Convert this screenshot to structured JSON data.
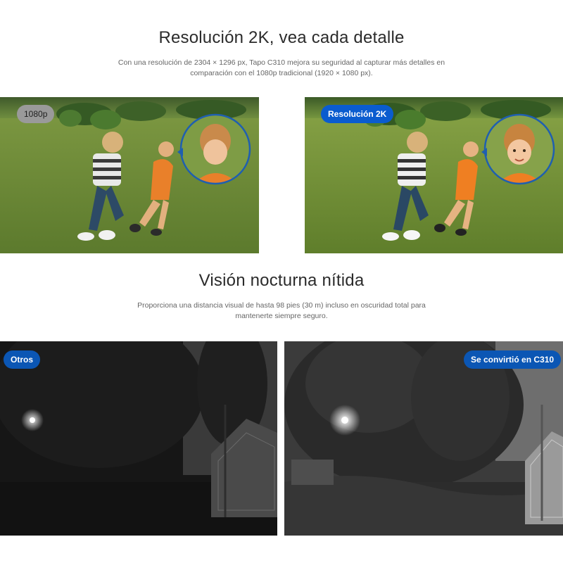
{
  "resolution_section": {
    "title": "Resolución 2K, vea cada detalle",
    "subtitle_line1": "Con una resolución de 2304 × 1296 px, Tapo C310 mejora su seguridad al capturar más detalles en",
    "subtitle_line2": "comparación con el 1080p tradicional (1920 × 1080 px).",
    "left_badge": "1080p",
    "right_badge": "Resolución 2K"
  },
  "night_section": {
    "title": "Visión nocturna nítida",
    "subtitle_line1": "Proporciona una distancia visual de hasta 98 pies (30 m) incluso en oscuridad total para",
    "subtitle_line2": "mantenerte siempre seguro.",
    "left_badge": "Otros",
    "right_badge": "Se convirtió en C310"
  },
  "colors": {
    "badge_blue": "#0a5ccf",
    "badge_gray": "#9a9a9a",
    "zoom_ring": "#1f5fb0"
  }
}
